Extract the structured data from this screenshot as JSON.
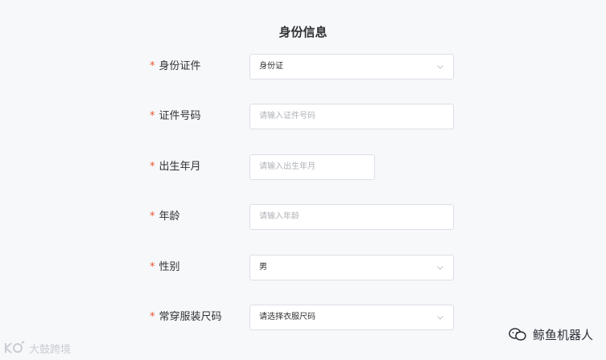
{
  "form": {
    "title": "身份信息",
    "required_mark": "*",
    "fields": [
      {
        "label": "身份证件",
        "type": "select",
        "value": "身份证",
        "placeholder": ""
      },
      {
        "label": "证件号码",
        "type": "input",
        "value": "",
        "placeholder": "请输入证件号码"
      },
      {
        "label": "出生年月",
        "type": "input",
        "value": "",
        "placeholder": "请输入出生年月"
      },
      {
        "label": "年龄",
        "type": "input",
        "value": "",
        "placeholder": "请输入年龄"
      },
      {
        "label": "性别",
        "type": "select",
        "value": "男",
        "placeholder": ""
      },
      {
        "label": "常穿服装尺码",
        "type": "select",
        "value": "",
        "placeholder": "请选择衣服尺码"
      }
    ]
  },
  "watermarks": {
    "left": "大鼓跨境",
    "right": "鲸鱼机器人"
  },
  "colors": {
    "required": "#e4572e",
    "border": "#dcdfe6",
    "placeholder": "#b0b3b8",
    "background": "#f7f8fa"
  }
}
